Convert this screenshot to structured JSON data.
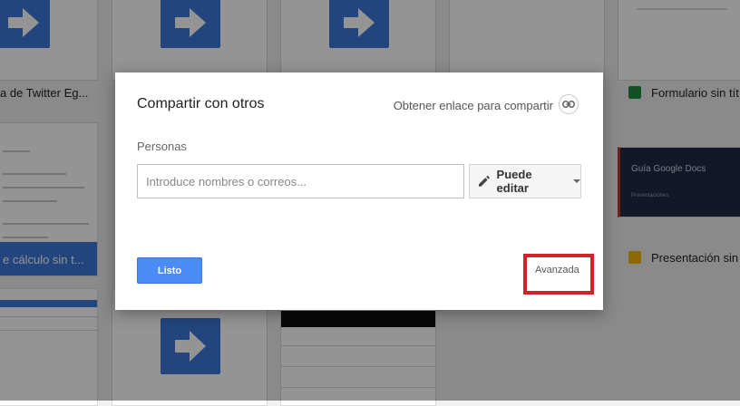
{
  "background": {
    "doc_titles": [
      "a de Twitter Eg...",
      "Formulario sin tít",
      "Presentación sin"
    ],
    "blue_band_title": "e cálculo sin t...",
    "slide_card": {
      "title": "Guía Google Docs",
      "subtitle": "Presentaciones"
    }
  },
  "dialog": {
    "title": "Compartir con otros",
    "share_link_label": "Obtener enlace para compartir",
    "people_label": "Personas",
    "people_input_placeholder": "Introduce nombres o correos...",
    "permission_label": "Puede editar",
    "done_button": "Listo",
    "advanced_link": "Avanzada"
  },
  "annotation": {
    "highlight_color": "#d62027"
  }
}
